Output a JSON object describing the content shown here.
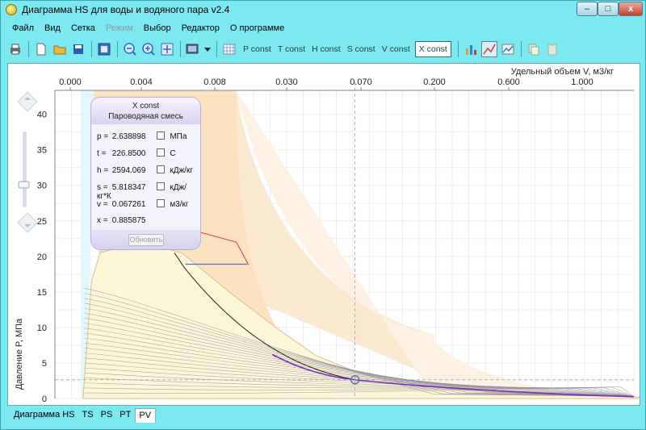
{
  "window": {
    "title": "Диаграмма HS для воды и водяного пара v2.4",
    "min_label": "–",
    "max_label": "□",
    "close_label": "x"
  },
  "menu": [
    {
      "label": "Файл",
      "disabled": false
    },
    {
      "label": "Вид",
      "disabled": false
    },
    {
      "label": "Сетка",
      "disabled": false
    },
    {
      "label": "Режим",
      "disabled": true
    },
    {
      "label": "Выбор",
      "disabled": false
    },
    {
      "label": "Редактор",
      "disabled": false
    },
    {
      "label": "О программе",
      "disabled": false
    }
  ],
  "toolbar": {
    "icons": [
      "print-icon",
      "new-file-icon",
      "open-folder-icon",
      "save-icon",
      "export-icon",
      "zoom-out-icon",
      "zoom-in-icon",
      "zoom-fit-icon",
      "display-settings-icon",
      "grid-icon",
      "chart-bar-icon",
      "chart-line-icon",
      "chart-edit-icon",
      "copy-icon",
      "paste-icon"
    ],
    "const_buttons": [
      "P const",
      "T const",
      "H const",
      "S const",
      "V const",
      "X const"
    ],
    "active_const": "X const"
  },
  "info_panel": {
    "title": "X const",
    "subtitle": "Пароводяная смесь",
    "rows": [
      {
        "label": "p =",
        "value": "2.638898",
        "unit": "МПа",
        "has_check": true
      },
      {
        "label": "t =",
        "value": "226.8500",
        "unit": "C",
        "has_check": true
      },
      {
        "label": "h =",
        "value": "2594.069",
        "unit": "кДж/кг",
        "has_check": true
      },
      {
        "label": "s =",
        "value": "5.818347",
        "unit": "кДж/кг*К",
        "has_check": true
      },
      {
        "label": "v =",
        "value": "0.067261",
        "unit": "м3/кг",
        "has_check": true
      },
      {
        "label": "x =",
        "value": "0.885875",
        "unit": "",
        "has_check": false
      }
    ],
    "refresh_label": "Обновить"
  },
  "tabs": [
    {
      "label": "Диаграмма HS",
      "active": false
    },
    {
      "label": "TS",
      "active": false
    },
    {
      "label": "PS",
      "active": false
    },
    {
      "label": "PT",
      "active": false
    },
    {
      "label": "PV",
      "active": true
    }
  ],
  "chart_data": {
    "type": "line",
    "xlabel": "Удельный объем V, м3/кг",
    "ylabel": "Давление P, МПа",
    "x_ticks": [
      "0.000",
      "0.004",
      "0.008",
      "0.030",
      "0.070",
      "0.200",
      "0.600",
      "1.000"
    ],
    "y_ticks": [
      "0",
      "5",
      "10",
      "15",
      "20",
      "25",
      "30",
      "35",
      "40"
    ],
    "ylim": [
      0,
      42
    ],
    "x_axis_position": "top",
    "grid": true,
    "cursor": {
      "v": 0.067261,
      "p": 2.638898
    },
    "saturation_curve_points": [
      {
        "xpos": 0.18,
        "p": 0
      },
      {
        "xpos": 0.3,
        "p": 16.6
      },
      {
        "xpos": 0.42,
        "p": 20.5
      },
      {
        "xpos": 1.0,
        "p": 22.06
      },
      {
        "xpos": 1.55,
        "p": 20.5
      },
      {
        "xpos": 2.2,
        "p": 15
      },
      {
        "xpos": 2.85,
        "p": 10
      },
      {
        "xpos": 3.4,
        "p": 6
      },
      {
        "xpos": 4.0,
        "p": 3.5
      },
      {
        "xpos": 4.6,
        "p": 2.2
      },
      {
        "xpos": 5.2,
        "p": 1.4
      },
      {
        "xpos": 6.0,
        "p": 0.8
      },
      {
        "xpos": 7.0,
        "p": 0.4
      },
      {
        "xpos": 8.1,
        "p": 0.15
      }
    ],
    "colors": {
      "vapor_dome": "#fdf6d8",
      "supercritical": "#fbe2c2",
      "superheated": "#fce9d2",
      "liquid": "#e4f8fb",
      "isoline": "#8c8a97",
      "x_const_curve": "#7c2fbf",
      "critical_line": "#d13a3a",
      "cursor": "#4f62b8"
    }
  }
}
